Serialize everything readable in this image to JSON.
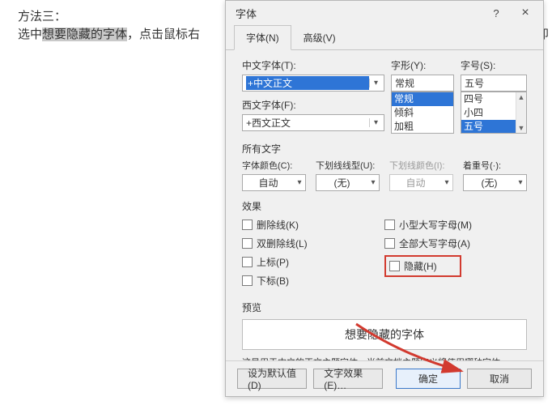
{
  "background": {
    "line1": "方法三：",
    "line2_a": "选中",
    "line2_sel": "想要隐藏的字体",
    "line2_b": "，点击鼠标右",
    "line2_right": "能即"
  },
  "dialog": {
    "title": "字体",
    "help": "?",
    "close": "×",
    "tabs": {
      "font": "字体(N)",
      "advanced": "高级(V)"
    },
    "cjkFontLabel": "中文字体(T):",
    "cjkFontValue": "+中文正文",
    "latinFontLabel": "西文字体(F):",
    "latinFontValue": "+西文正文",
    "styleLabel": "字形(Y):",
    "styleValue": "常规",
    "styleOptions": [
      "常规",
      "倾斜",
      "加粗"
    ],
    "sizeLabel": "字号(S):",
    "sizeValue": "五号",
    "sizeOptions": [
      "四号",
      "小四",
      "五号"
    ],
    "allTextLabel": "所有文字",
    "colorLabel": "字体颜色(C):",
    "colorValue": "自动",
    "underlineLabel": "下划线线型(U):",
    "underlineValue": "(无)",
    "underlineColorLabel": "下划线颜色(I):",
    "underlineColorValue": "自动",
    "emphasisLabel": "着重号(·):",
    "emphasisValue": "(无)",
    "effectsLabel": "效果",
    "effects": {
      "strike": "删除线(K)",
      "dblstrike": "双删除线(L)",
      "superscript": "上标(P)",
      "subscript": "下标(B)",
      "smallcaps": "小型大写字母(M)",
      "allcaps": "全部大写字母(A)",
      "hidden": "隐藏(H)"
    },
    "previewLabel": "预览",
    "previewText": "想要隐藏的字体",
    "note": "这是用于中文的正文主题字体。当前文档主题定义将使用哪种字体。",
    "buttons": {
      "defaults": "设为默认值(D)",
      "textEffects": "文字效果(E)…",
      "ok": "确定",
      "cancel": "取消"
    }
  }
}
